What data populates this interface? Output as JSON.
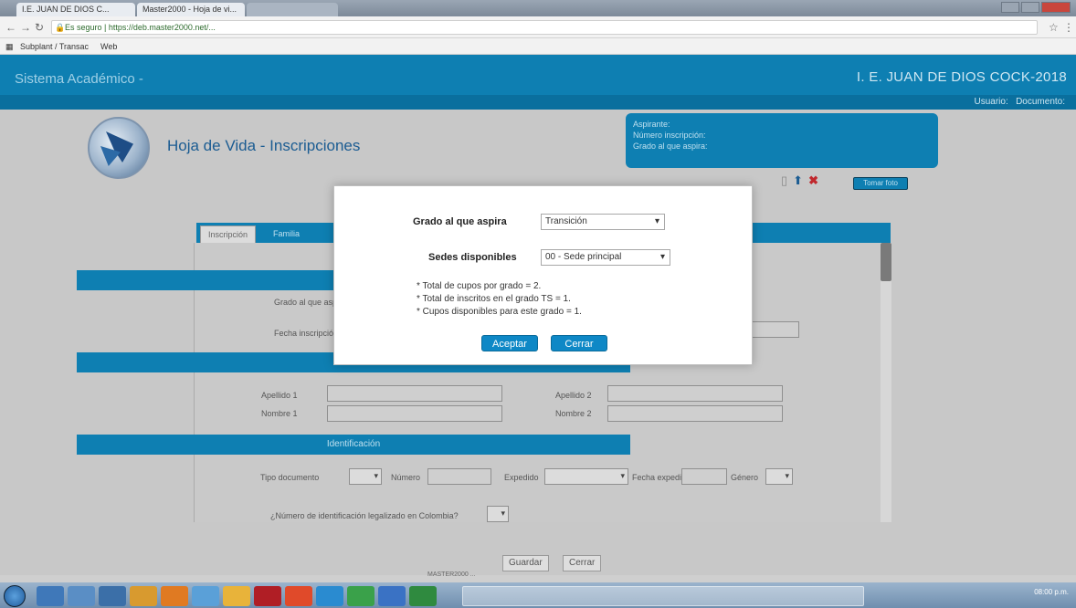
{
  "browser": {
    "tabs": [
      {
        "label": "I.E. JUAN DE DIOS C..."
      },
      {
        "label": "Master2000 - Hoja de vi..."
      },
      {
        "label": ""
      }
    ],
    "url": "Es seguro | https://deb.master2000.net/...",
    "bookmarks": [
      "Subplant / Transac",
      "Web"
    ]
  },
  "header": {
    "app_title": "Sistema Académico -",
    "school": "I. E. JUAN DE DIOS COCK-2018",
    "user_label": "Usuario:",
    "document_label": "Documento:"
  },
  "page": {
    "title": "Hoja de Vida - Inscripciones",
    "aspirant_box": {
      "line1": "Aspirante:",
      "line2": "Número inscripción:",
      "line3": "Grado al que aspira:"
    },
    "photo_button": "Tomar foto",
    "tabs": [
      "Inscripción",
      "Familia"
    ],
    "form": {
      "grado_label": "Grado al que aspira",
      "fecha_label": "Fecha inscripción",
      "apellido1": "Apellido 1",
      "nombre1": "Nombre 1",
      "apellido2": "Apellido 2",
      "nombre2": "Nombre 2",
      "identificacion_section": "Identificación",
      "tipo_doc": "Tipo documento",
      "numero": "Número",
      "expedido": "Expedido",
      "fecha_exp": "Fecha expedición",
      "genero": "Género",
      "legalizado": "¿Número de identificación legalizado en Colombia?"
    },
    "buttons": {
      "guardar": "Guardar",
      "cerrar": "Cerrar"
    },
    "footer": "MASTER2000 ..."
  },
  "modal": {
    "grado_label": "Grado al que aspira",
    "grado_value": "Transición",
    "sedes_label": "Sedes disponibles",
    "sedes_value": "00 - Sede principal",
    "notes": [
      "* Total de cupos por grado = 2.",
      "* Total de inscritos en el grado TS = 1.",
      "* Cupos disponibles para este grado = 1."
    ],
    "accept": "Aceptar",
    "close": "Cerrar"
  },
  "taskbar": {
    "time": "08:00 p.m.",
    "date": ""
  },
  "colors": {
    "brand_blue": "#0e7fb2",
    "button_blue": "#0e88c6"
  }
}
